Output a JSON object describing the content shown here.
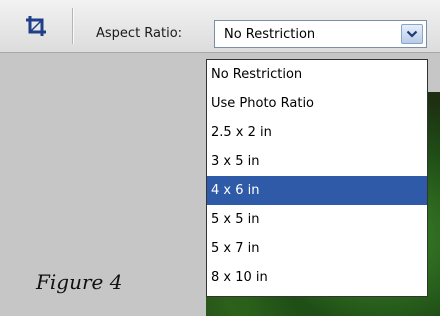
{
  "toolbar": {
    "crop_icon": "crop-icon",
    "aspect_ratio_label": "Aspect Ratio:",
    "aspect_ratio_value": "No Restriction",
    "dropdown_arrow_icon": "chevron-down-icon"
  },
  "dropdown": {
    "options": [
      {
        "label": "No Restriction",
        "selected": false
      },
      {
        "label": "Use Photo Ratio",
        "selected": false
      },
      {
        "label": "2.5 x 2 in",
        "selected": false
      },
      {
        "label": "3 x 5 in",
        "selected": false
      },
      {
        "label": "4 x 6 in",
        "selected": true
      },
      {
        "label": "5 x 5 in",
        "selected": false
      },
      {
        "label": "5 x 7 in",
        "selected": false
      },
      {
        "label": "8 x 10 in",
        "selected": false
      }
    ]
  },
  "caption": "Figure 4",
  "colors": {
    "accent_crop_icon": "#1f3f88",
    "highlight": "#2f5aa8"
  }
}
